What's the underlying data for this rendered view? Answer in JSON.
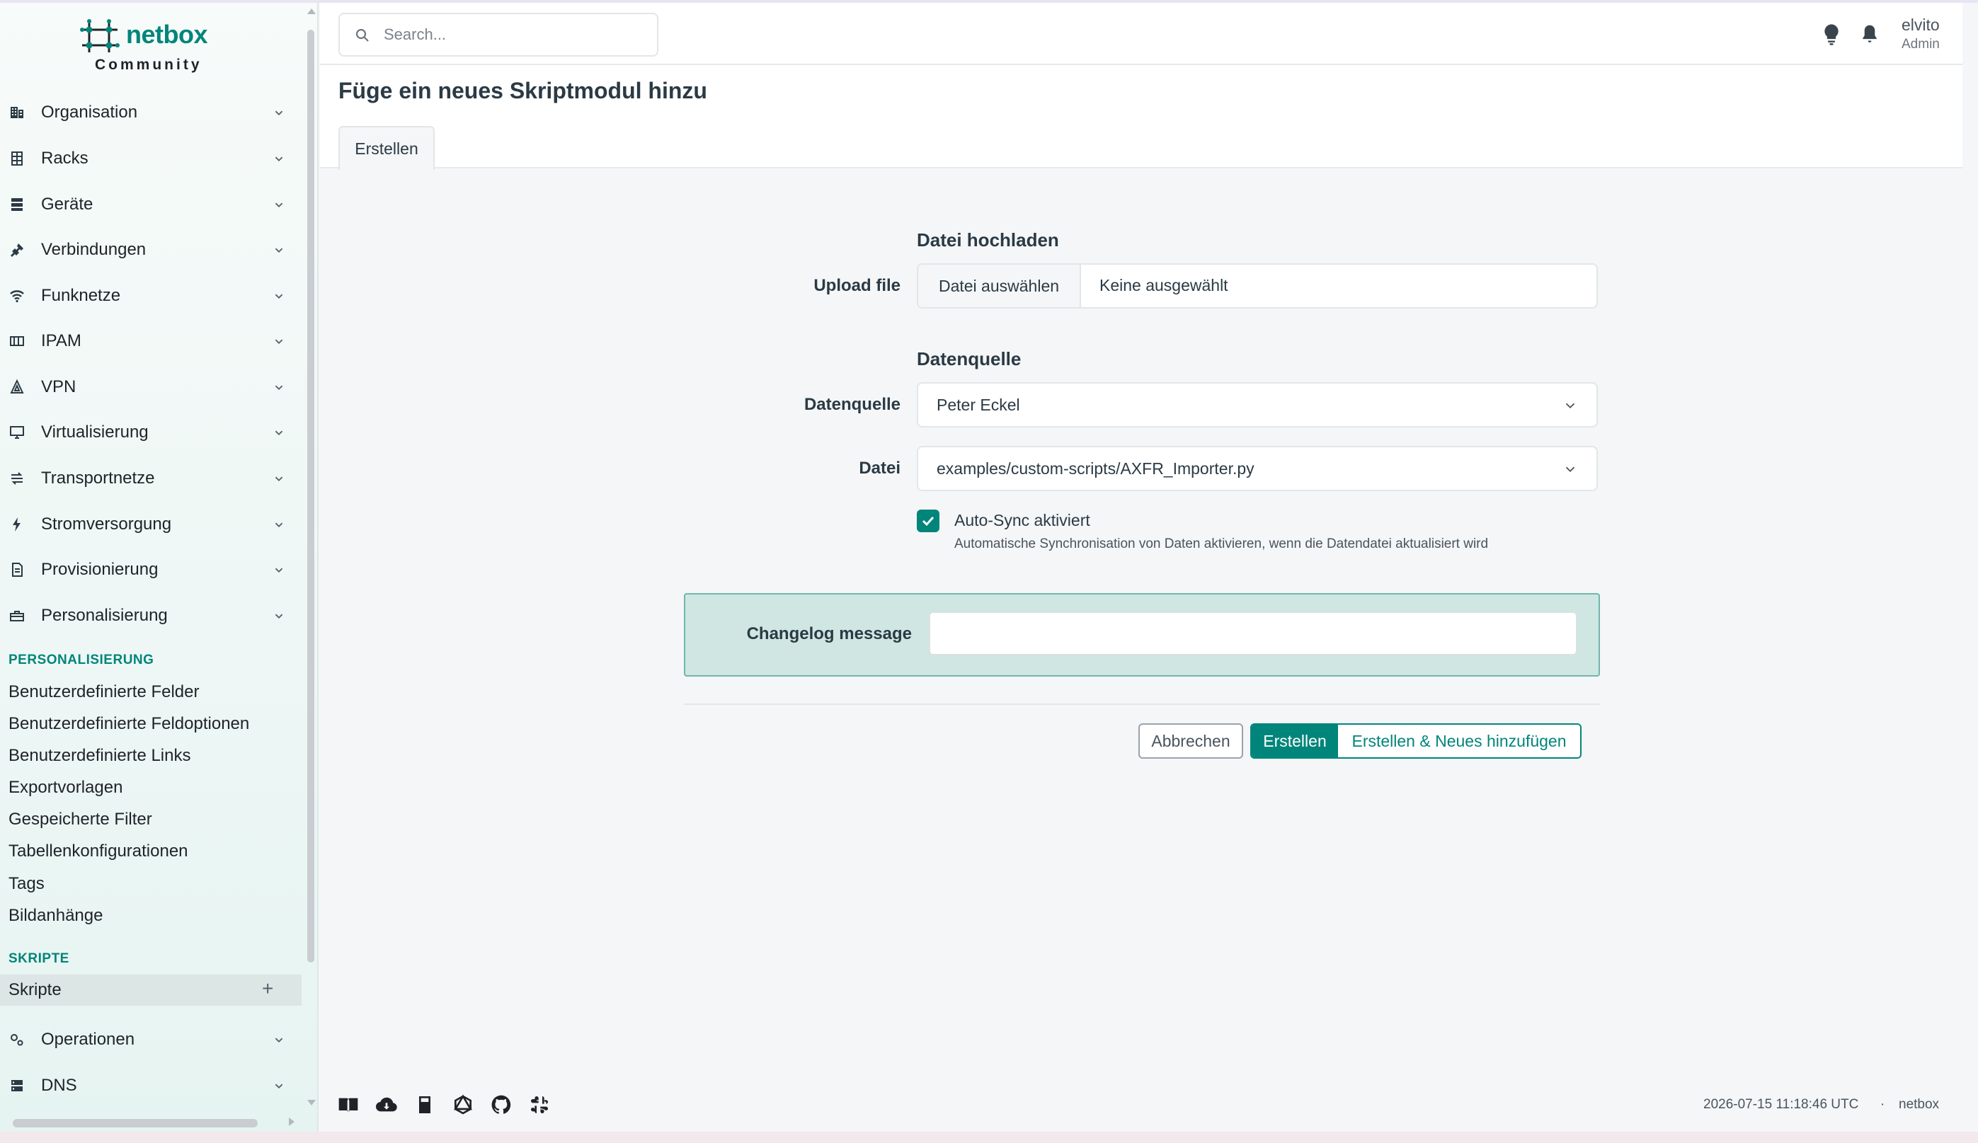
{
  "brand": {
    "name": "netbox",
    "edition": "Community",
    "color": "#00857a"
  },
  "sidebar": {
    "menus": [
      {
        "label": "Organisation",
        "icon": "building-icon"
      },
      {
        "label": "Racks",
        "icon": "rack-icon"
      },
      {
        "label": "Geräte",
        "icon": "server-icon"
      },
      {
        "label": "Verbindungen",
        "icon": "plug-icon"
      },
      {
        "label": "Funknetze",
        "icon": "wifi-icon"
      },
      {
        "label": "IPAM",
        "icon": "counter-icon"
      },
      {
        "label": "VPN",
        "icon": "tunnel-icon"
      },
      {
        "label": "Virtualisierung",
        "icon": "monitor-icon"
      },
      {
        "label": "Transportnetze",
        "icon": "transit-icon"
      },
      {
        "label": "Stromversorgung",
        "icon": "flash-icon"
      },
      {
        "label": "Provisionierung",
        "icon": "file-document-icon"
      },
      {
        "label": "Personalisierung",
        "icon": "toolbox-icon"
      }
    ],
    "personalisierung_header": "PERSONALISIERUNG",
    "personalisierung_links": [
      "Benutzerdefinierte Felder",
      "Benutzerdefinierte Feldoptionen",
      "Benutzerdefinierte Links",
      "Exportvorlagen",
      "Gespeicherte Filter",
      "Tabellenkonfigurationen",
      "Tags",
      "Bildanhänge"
    ],
    "skripte_header": "SKRIPTE",
    "skripte_active": "Skripte",
    "skripte_add": "+",
    "bottom_menus": [
      {
        "label": "Operationen",
        "icon": "cogs-icon"
      },
      {
        "label": "DNS",
        "icon": "dns-icon"
      }
    ]
  },
  "header": {
    "search_placeholder": "Search...",
    "user_name": "elvito",
    "user_role": "Admin"
  },
  "page": {
    "title": "Füge ein neues Skriptmodul hinzu",
    "tab": "Erstellen"
  },
  "form": {
    "upload_section": "Datei hochladen",
    "upload_label": "Upload file",
    "file_button": "Datei auswählen",
    "file_status": "Keine ausgewählt",
    "datasource_section": "Datenquelle",
    "datasource_label": "Datenquelle",
    "datasource_value": "Peter Eckel",
    "file_label": "Datei",
    "file_value": "examples/custom-scripts/AXFR_Importer.py",
    "autosync_label": "Auto-Sync aktiviert",
    "autosync_checked": true,
    "autosync_help": "Automatische Synchronisation von Daten aktivieren, wenn die Datendatei aktualisiert wird",
    "changelog_label": "Changelog message",
    "changelog_value": ""
  },
  "buttons": {
    "cancel": "Abbrechen",
    "create": "Erstellen",
    "create_add": "Erstellen & Neues hinzufügen"
  },
  "footer": {
    "icons": [
      "docs-icon",
      "cloud-api-icon",
      "book-icon",
      "graphql-icon",
      "github-icon",
      "slack-icon"
    ],
    "timestamp": "2026-07-15 11:18:46 UTC",
    "separator": "·",
    "brand": "netbox"
  }
}
